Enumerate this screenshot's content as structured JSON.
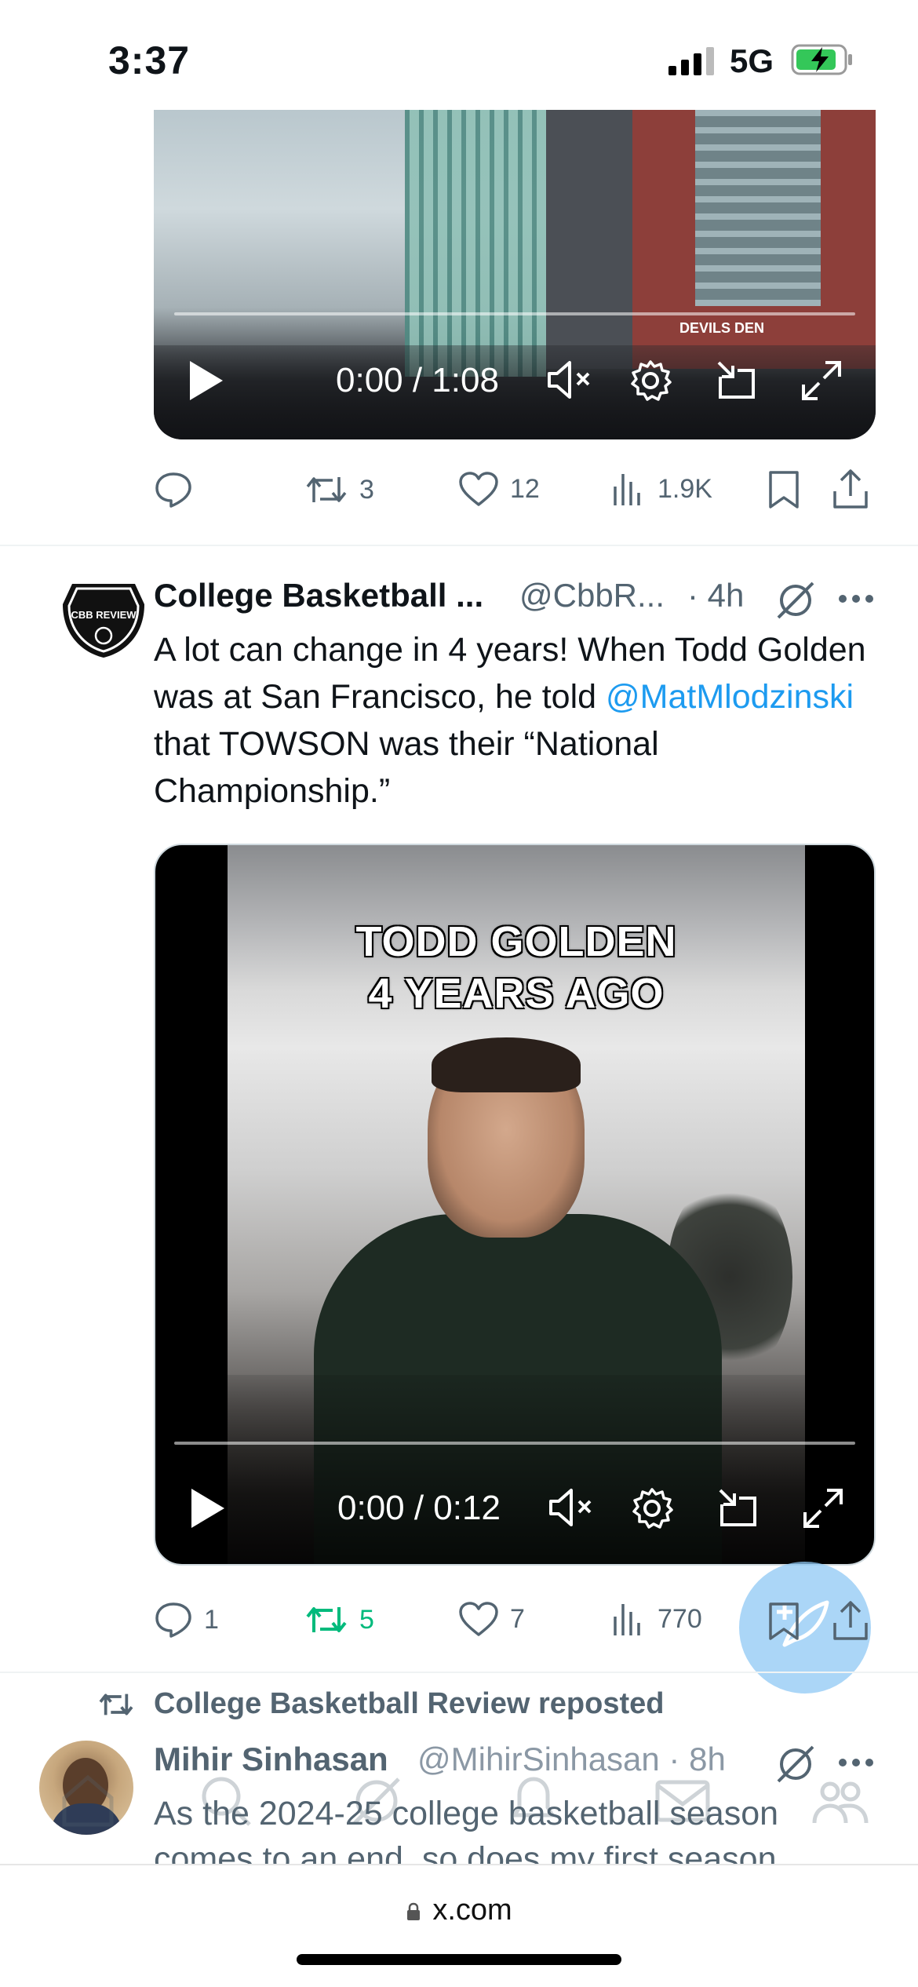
{
  "status": {
    "time": "3:37",
    "network": "5G"
  },
  "tweet1": {
    "video": {
      "time_display": "0:00 / 1:08",
      "sign_text": "DEVILS DEN"
    },
    "actions": {
      "replies": "",
      "reposts": "3",
      "likes": "12",
      "views": "1.9K"
    }
  },
  "tweet2": {
    "author": "College Basketball ...",
    "handle": "@CbbR...",
    "time": "· 4h",
    "text_before": "A lot can change in 4 years! When Todd Golden was at San Francisco, he told ",
    "mention": "@MatMlodzinski",
    "text_after": " that TOWSON was their “National Championship.”",
    "avatar_text": "CBB REVIEW",
    "video": {
      "caption_line1": "TODD GOLDEN",
      "caption_line2": "4 YEARS AGO",
      "time_display": "0:00 / 0:12"
    },
    "actions": {
      "replies": "1",
      "reposts": "5",
      "likes": "7",
      "views": "770"
    }
  },
  "repost_line": "College Basketball Review reposted",
  "tweet3": {
    "author": "Mihir Sinhasan",
    "handle": "@MihirSinhasan · 8h",
    "text": "As the 2024-25 college basketball season comes to an end, so does my first season"
  },
  "browser": {
    "url": "x.com"
  },
  "colors": {
    "accent": "#1d9bf0",
    "repost_active": "#00ba7c",
    "secondary_text": "#536471"
  }
}
